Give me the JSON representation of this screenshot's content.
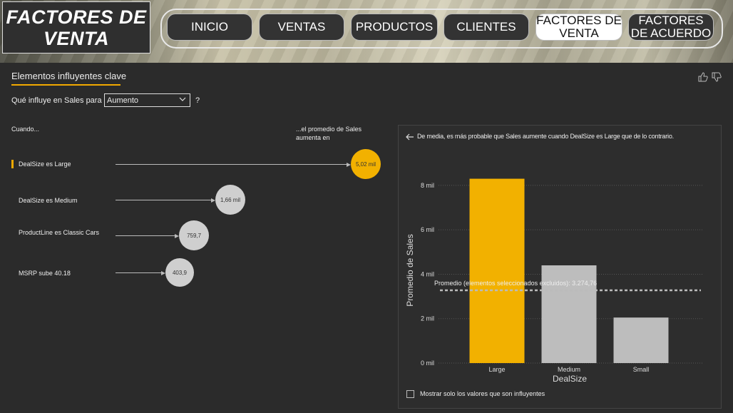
{
  "header": {
    "title": "FACTORES DE\nVENTA",
    "nav": [
      {
        "label": "INICIO",
        "active": false
      },
      {
        "label": "VENTAS",
        "active": false
      },
      {
        "label": "PRODUCTOS",
        "active": false
      },
      {
        "label": "CLIENTES",
        "active": false
      },
      {
        "label": "FACTORES DE VENTA",
        "active": true
      },
      {
        "label": "FACTORES DE ACUERDO",
        "active": false
      }
    ]
  },
  "visual": {
    "title": "Elementos influyentes clave",
    "question_label": "Qué influye en Sales para",
    "dropdown_value": "Aumento",
    "question_mark": "?",
    "col_when": "Cuando...",
    "col_effect": "...el promedio de Sales aumenta en",
    "influencers": [
      {
        "label": "DealSize es Large",
        "value": "5,02 mil",
        "amount": 5020,
        "selected": true
      },
      {
        "label": "DealSize es Medium",
        "value": "1,66 mil",
        "amount": 1660,
        "selected": false
      },
      {
        "label": "ProductLine es Classic Cars",
        "value": "759,7",
        "amount": 759.7,
        "selected": false
      },
      {
        "label": "MSRP sube 40.18",
        "value": "403,9",
        "amount": 403.9,
        "selected": false
      }
    ],
    "panel_note": "De media, es más probable que Sales aumente cuando DealSize es Large que de lo contrario.",
    "checkbox_label": "Mostrar solo los valores que son influyentes",
    "accent_color": "#F2B100",
    "neutral_color": "#BDBDBD"
  },
  "chart_data": {
    "type": "bar",
    "categories": [
      "Large",
      "Medium",
      "Small"
    ],
    "values": [
      8300,
      4400,
      2050
    ],
    "colors": [
      "#F2B100",
      "#BDBDBD",
      "#BDBDBD"
    ],
    "xlabel": "DealSize",
    "ylabel": "Promedio de Sales",
    "ylim": [
      0,
      8800
    ],
    "yticks": [
      {
        "v": 0,
        "label": "0 mil"
      },
      {
        "v": 2000,
        "label": "2 mil"
      },
      {
        "v": 4000,
        "label": "4 mil"
      },
      {
        "v": 6000,
        "label": "6 mil"
      },
      {
        "v": 8000,
        "label": "8 mil"
      }
    ],
    "reference_line": {
      "value": 3274.76,
      "label": "Promedio (elementos seleccionados excluidos): 3.274,76"
    },
    "grid": true
  }
}
